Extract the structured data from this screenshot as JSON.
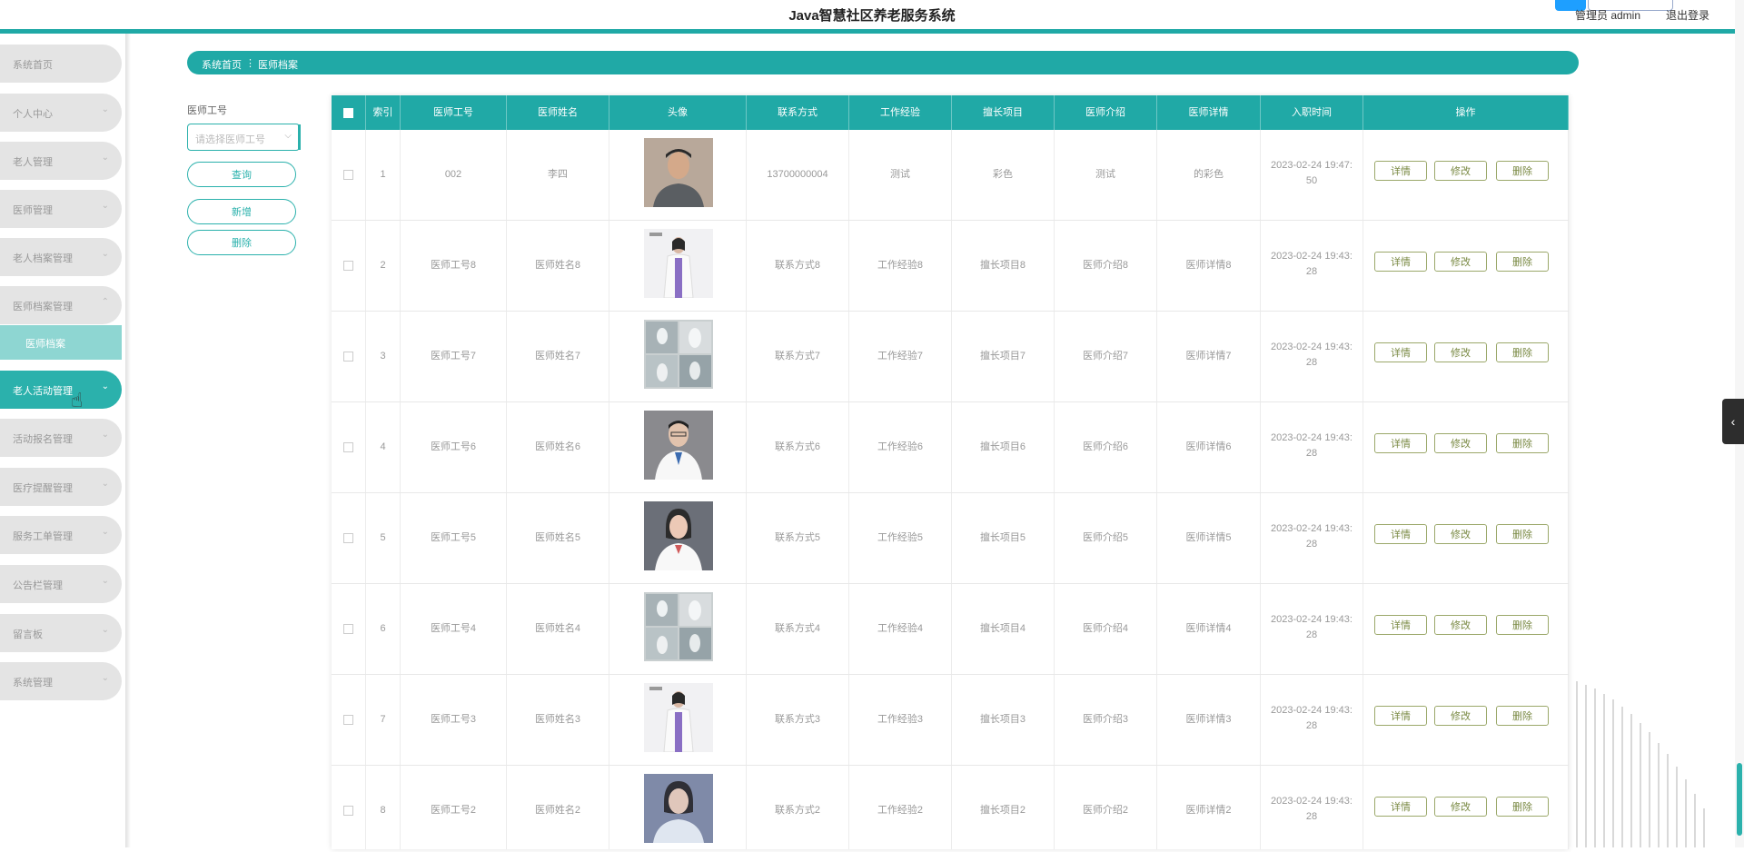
{
  "header": {
    "title": "Java智慧社区养老服务系统",
    "user": "管理员 admin",
    "logout": "退出登录"
  },
  "sidebar": {
    "items": [
      {
        "label": "系统首页",
        "chevron": false
      },
      {
        "label": "个人中心",
        "chevron": true
      },
      {
        "label": "老人管理",
        "chevron": true
      },
      {
        "label": "医师管理",
        "chevron": true
      },
      {
        "label": "老人档案管理",
        "chevron": true
      },
      {
        "label": "医师档案管理",
        "chevron": true,
        "expanded": true
      },
      {
        "label": "老人活动管理",
        "chevron": true,
        "active": true
      },
      {
        "label": "活动报名管理",
        "chevron": true
      },
      {
        "label": "医疗提醒管理",
        "chevron": true
      },
      {
        "label": "服务工单管理",
        "chevron": true
      },
      {
        "label": "公告栏管理",
        "chevron": true
      },
      {
        "label": "留言板",
        "chevron": true
      },
      {
        "label": "系统管理",
        "chevron": true
      }
    ],
    "subitem": "医师档案"
  },
  "breadcrumb": {
    "home": "系统首页",
    "sep": "⋮",
    "current": "医师档案"
  },
  "filters": {
    "label": "医师工号",
    "placeholder": "请选择医师工号",
    "search_btn": "查询",
    "add_btn": "新增",
    "delete_btn": "删除"
  },
  "table": {
    "headers": [
      "索引",
      "医师工号",
      "医师姓名",
      "头像",
      "联系方式",
      "工作经验",
      "擅长项目",
      "医师介绍",
      "医师详情",
      "入职时间",
      "操作"
    ],
    "actions": {
      "detail": "详情",
      "edit": "修改",
      "delete": "删除"
    },
    "rows": [
      {
        "idx": "1",
        "code": "002",
        "name": "李四",
        "avatar": "photo-man-gray-shirt",
        "contact": "13700000004",
        "exp": "测试",
        "skill": "彩色",
        "intro": "测试",
        "detail": "的彩色",
        "date": "2023-02-24 19:47:",
        "sec": "50"
      },
      {
        "idx": "2",
        "code": "医师工号8",
        "name": "医师姓名8",
        "avatar": "photo-female-doctor-purple",
        "contact": "联系方式8",
        "exp": "工作经验8",
        "skill": "擅长项目8",
        "intro": "医师介绍8",
        "detail": "医师详情8",
        "date": "2023-02-24 19:43:",
        "sec": "28"
      },
      {
        "idx": "3",
        "code": "医师工号7",
        "name": "医师姓名7",
        "avatar": "photo-medical-team-collage",
        "contact": "联系方式7",
        "exp": "工作经验7",
        "skill": "擅长项目7",
        "intro": "医师介绍7",
        "detail": "医师详情7",
        "date": "2023-02-24 19:43:",
        "sec": "28"
      },
      {
        "idx": "4",
        "code": "医师工号6",
        "name": "医师姓名6",
        "avatar": "photo-male-doctor",
        "contact": "联系方式6",
        "exp": "工作经验6",
        "skill": "擅长项目6",
        "intro": "医师介绍6",
        "detail": "医师详情6",
        "date": "2023-02-24 19:43:",
        "sec": "28"
      },
      {
        "idx": "5",
        "code": "医师工号5",
        "name": "医师姓名5",
        "avatar": "photo-female-doctor",
        "contact": "联系方式5",
        "exp": "工作经验5",
        "skill": "擅长项目5",
        "intro": "医师介绍5",
        "detail": "医师详情5",
        "date": "2023-02-24 19:43:",
        "sec": "28"
      },
      {
        "idx": "6",
        "code": "医师工号4",
        "name": "医师姓名4",
        "avatar": "photo-medical-team-collage",
        "contact": "联系方式4",
        "exp": "工作经验4",
        "skill": "擅长项目4",
        "intro": "医师介绍4",
        "detail": "医师详情4",
        "date": "2023-02-24 19:43:",
        "sec": "28"
      },
      {
        "idx": "7",
        "code": "医师工号3",
        "name": "医师姓名3",
        "avatar": "photo-female-doctor-purple",
        "contact": "联系方式3",
        "exp": "工作经验3",
        "skill": "擅长项目3",
        "intro": "医师介绍3",
        "detail": "医师详情3",
        "date": "2023-02-24 19:43:",
        "sec": "28"
      },
      {
        "idx": "8",
        "code": "医师工号2",
        "name": "医师姓名2",
        "avatar": "photo-doctor-blue",
        "contact": "联系方式2",
        "exp": "工作经验2",
        "skill": "擅长项目2",
        "intro": "医师介绍2",
        "detail": "医师详情2",
        "date": "2023-02-24 19:43:",
        "sec": "28"
      }
    ]
  },
  "colors": {
    "accent": "#20a9a6",
    "active_menu": "#2bb1ac",
    "submenu": "#8ed6d2",
    "op_border": "#9ba86a"
  }
}
